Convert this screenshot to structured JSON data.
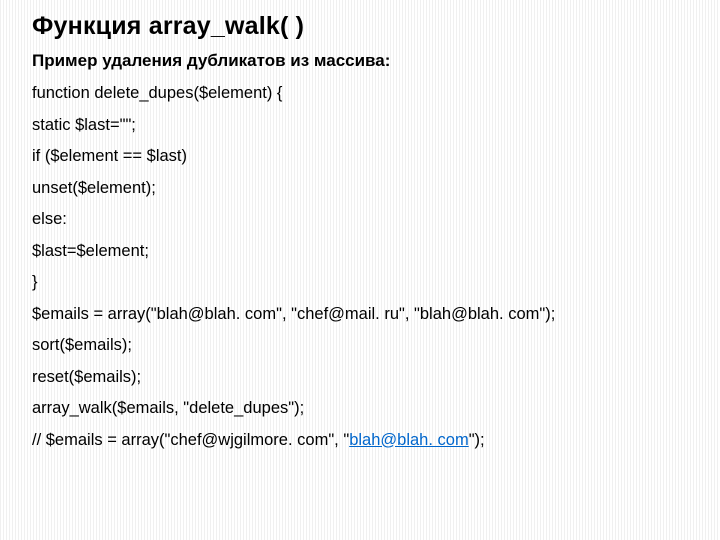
{
  "title": "Функция array_walk( )",
  "subtitle": "Пример удаления дубликатов из массива:",
  "code": {
    "l1": "function delete_dupes($element) {",
    "l2": "static $last=\"\";",
    "l3": "if ($element == $last)",
    "l4": "unset($element);",
    "l5": "else:",
    "l6": "$last=$element;",
    "l7": "}",
    "l8": "$emails = array(\"blah@blah. com\", \"chef@mail. ru\", \"blah@blah. com\");",
    "l9": "sort($emails);",
    "l10": "reset($emails);",
    "l11": "array_walk($emails, \"delete_dupes\");",
    "l12a": "// $emails = array(\"chef@wjgilmore. com\", \"",
    "l12b": "blah@blah. com",
    "l12c": "\");"
  }
}
